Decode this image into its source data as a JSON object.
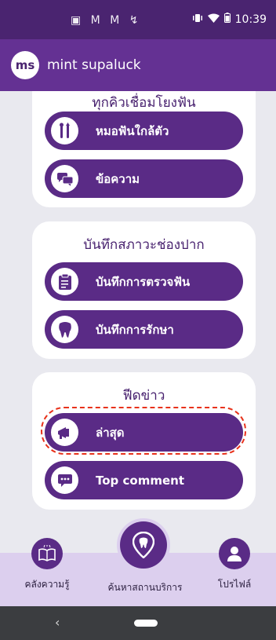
{
  "status_bar": {
    "notifications": "▣ M M ↯",
    "time": "10:39"
  },
  "app_bar": {
    "avatar_initials": "ms",
    "username": "mint supaluck"
  },
  "sections": [
    {
      "title": "ทุกคิวเชื่อมโยงฟัน",
      "items": [
        {
          "label": "หมอฟันใกล้ตัว",
          "icon": "dental-tools-icon"
        },
        {
          "label": "ข้อความ",
          "icon": "chat-icon"
        }
      ]
    },
    {
      "title": "บันทึกสภาวะช่องปาก",
      "items": [
        {
          "label": "บันทึกการตรวจฟัน",
          "icon": "clipboard-icon"
        },
        {
          "label": "บันทึกการรักษา",
          "icon": "tooth-icon"
        }
      ]
    },
    {
      "title": "ฟีดข่าว",
      "items": [
        {
          "label": "ล่าสุด",
          "icon": "megaphone-icon"
        },
        {
          "label": "Top comment",
          "icon": "comment-icon"
        }
      ]
    }
  ],
  "bottom_nav": {
    "knowledge_label": "คลังความรู้",
    "search_label": "ค้นหาสถานบริการ",
    "profile_label": "โปรไฟล์"
  },
  "colors": {
    "status_bar": "#4a2470",
    "app_bar": "#643193",
    "button": "#5a2b86",
    "nav_bg": "#dccfee",
    "highlight": "#e8321b"
  }
}
